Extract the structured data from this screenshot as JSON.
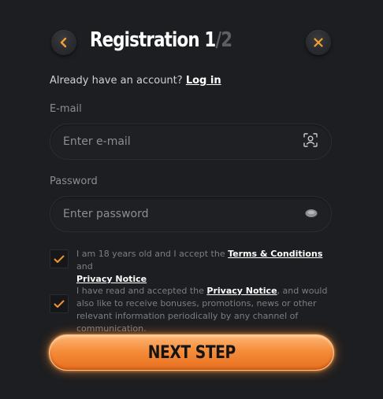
{
  "header": {
    "title_main": "Registration 1",
    "title_rest": "/2"
  },
  "account": {
    "question": "Already have an account?",
    "login_link": "Log in"
  },
  "email": {
    "label": "E-mail",
    "placeholder": "Enter e-mail",
    "value": ""
  },
  "password": {
    "label": "Password",
    "placeholder": "Enter password",
    "value": ""
  },
  "consents": [
    {
      "checked": true,
      "text_before": "I am 18 years old and I accept the ",
      "link1": "Terms & Conditions",
      "text_middle": " and ",
      "link2": "Privacy Notice",
      "text_after": ""
    },
    {
      "checked": true,
      "text_before": "I have read and accepted the ",
      "link1": "Privacy Notice",
      "text_after": ", and would also like to receive bonuses, promotions, news or other relevant information periodically by any channel of communication."
    }
  ],
  "actions": {
    "next_label": "NEXT STEP"
  },
  "colors": {
    "accent": "#f58d3a",
    "background": "#1d1e21",
    "icon_orange": "#f0a030"
  },
  "icons": {
    "back": "chevron-left-icon",
    "close": "close-icon",
    "email_field": "user-scan-icon",
    "password_field": "eye-icon",
    "check": "check-icon"
  }
}
